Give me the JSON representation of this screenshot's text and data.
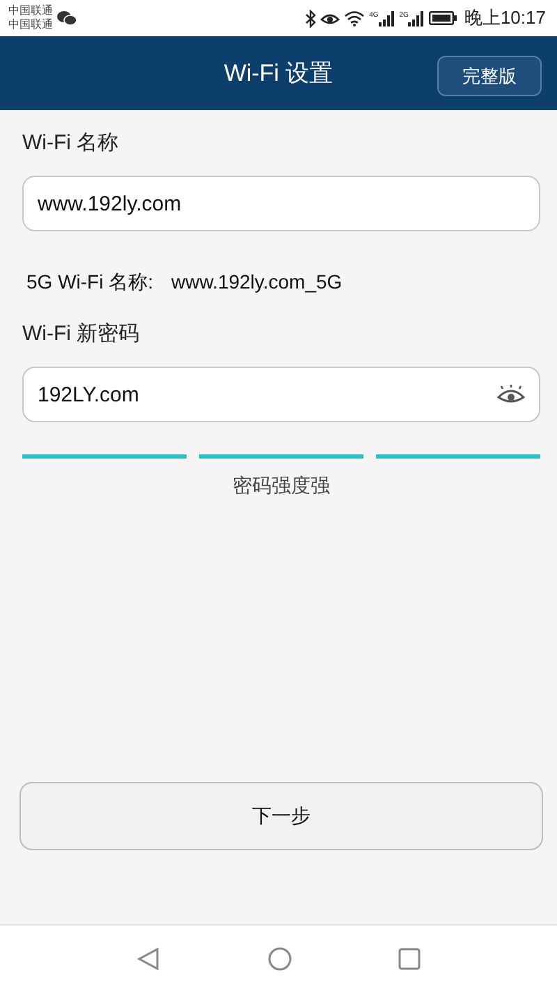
{
  "status_bar": {
    "carriers": [
      "中国联通",
      "中国联通"
    ],
    "network_labels": [
      "4G",
      "2G"
    ],
    "time": "晚上10:17"
  },
  "header": {
    "title": "Wi-Fi 设置",
    "action": "完整版"
  },
  "wifi_name": {
    "label": "Wi-Fi 名称",
    "value": "www.192ly.com"
  },
  "wifi_5g": {
    "label": "5G Wi-Fi 名称:",
    "value": "www.192ly.com_5G"
  },
  "password": {
    "label": "Wi-Fi 新密码",
    "value": "192LY.com"
  },
  "strength": {
    "segments": [
      {
        "on": true
      },
      {
        "on": true
      },
      {
        "on": true
      }
    ],
    "text": "密码强度强"
  },
  "next_button": "下一步"
}
